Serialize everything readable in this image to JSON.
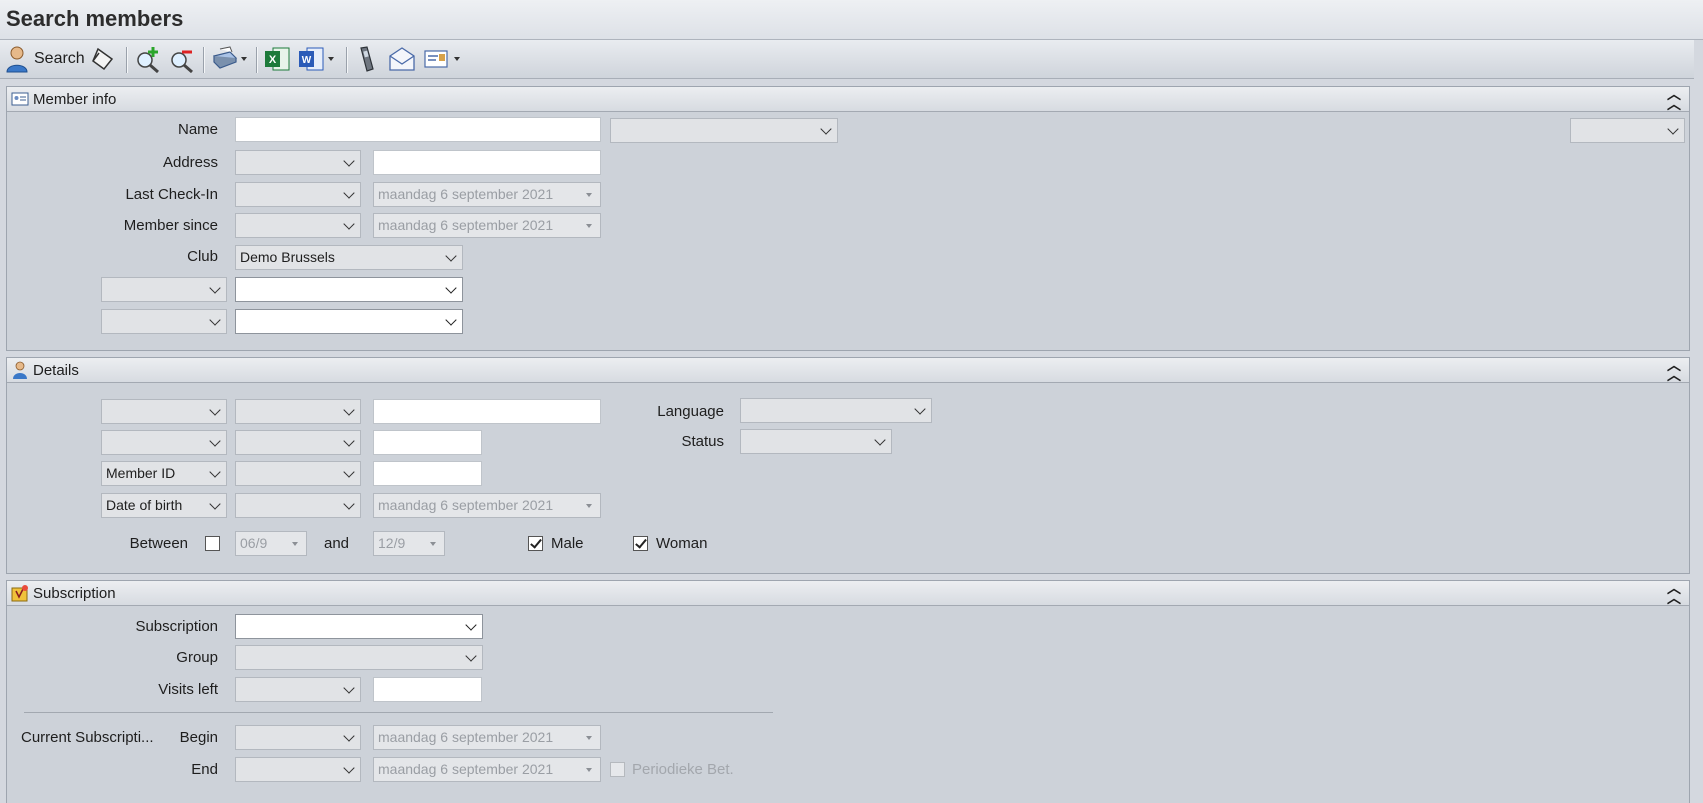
{
  "window": {
    "title": "Search members"
  },
  "toolbar": {
    "search_label": "Search",
    "icons": [
      "search-member-icon",
      "eraser-icon",
      "zoom-in-icon",
      "zoom-out-icon",
      "print-icon",
      "excel-icon",
      "word-icon",
      "phone-icon",
      "email-icon",
      "letter-template-icon"
    ]
  },
  "member_info": {
    "title": "Member info",
    "name_label": "Name",
    "name_value": "",
    "address_label": "Address",
    "last_checkin_label": "Last Check-In",
    "last_checkin_date": "maandag 6 september 2021",
    "member_since_label": "Member since",
    "member_since_date": "maandag 6 september 2021",
    "club_label": "Club",
    "club_value": "Demo Brussels"
  },
  "details": {
    "title": "Details",
    "language_label": "Language",
    "status_label": "Status",
    "member_id_option": "Member ID",
    "dob_option": "Date of birth",
    "dob_date": "maandag 6 september 2021",
    "between_label": "Between",
    "between_from": "06/9",
    "and_label": "and",
    "between_to": "12/9",
    "male_label": "Male",
    "woman_label": "Woman"
  },
  "subscription": {
    "title": "Subscription",
    "subscription_label": "Subscription",
    "group_label": "Group",
    "visits_left_label": "Visits left",
    "current_label": "Current Subscripti...",
    "begin_label": "Begin",
    "begin_date": "maandag 6 september 2021",
    "end_label": "End",
    "end_date": "maandag 6 september 2021",
    "periodic_label": "Periodieke Bet."
  },
  "colors": {
    "panel_bg": "#cdd2d9",
    "header_bg": "#dde1e7",
    "accent_excel": "#1d7a3a",
    "accent_word": "#2b5bb8"
  }
}
